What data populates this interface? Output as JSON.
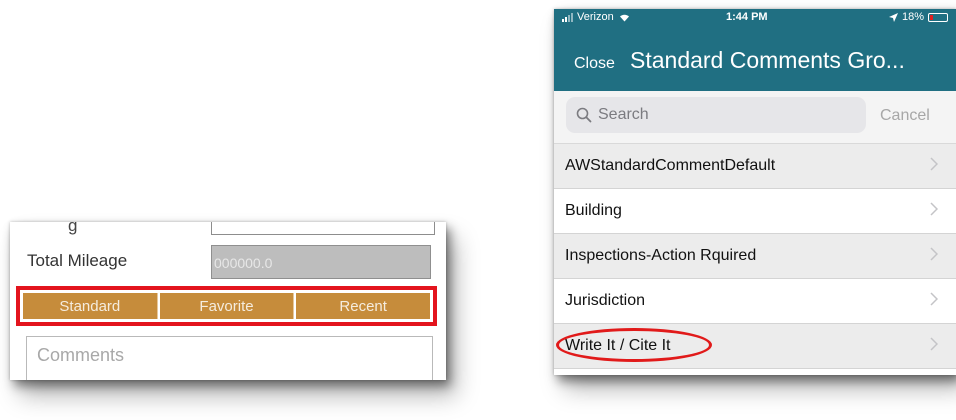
{
  "left_form": {
    "partial_label": "g",
    "mileage_label": "Total Mileage",
    "mileage_value": "000000.0",
    "buttons": [
      {
        "label": "Standard"
      },
      {
        "label": "Favorite"
      },
      {
        "label": "Recent"
      }
    ],
    "comments_placeholder": "Comments",
    "highlight_color": "#e3141d",
    "button_color": "#c68c3b"
  },
  "phone": {
    "status": {
      "carrier": "Verizon",
      "time": "1:44 PM",
      "battery": "18%",
      "battery_level": 0.18
    },
    "nav": {
      "close_label": "Close",
      "title": "Standard Comments Gro..."
    },
    "search": {
      "placeholder": "Search",
      "cancel_label": "Cancel"
    },
    "items": [
      {
        "label": "AWStandardCommentDefault"
      },
      {
        "label": "Building"
      },
      {
        "label": "Inspections-Action Rquired"
      },
      {
        "label": "Jurisdiction"
      },
      {
        "label": "Write It / Cite It"
      }
    ],
    "nav_color": "#206f82"
  }
}
